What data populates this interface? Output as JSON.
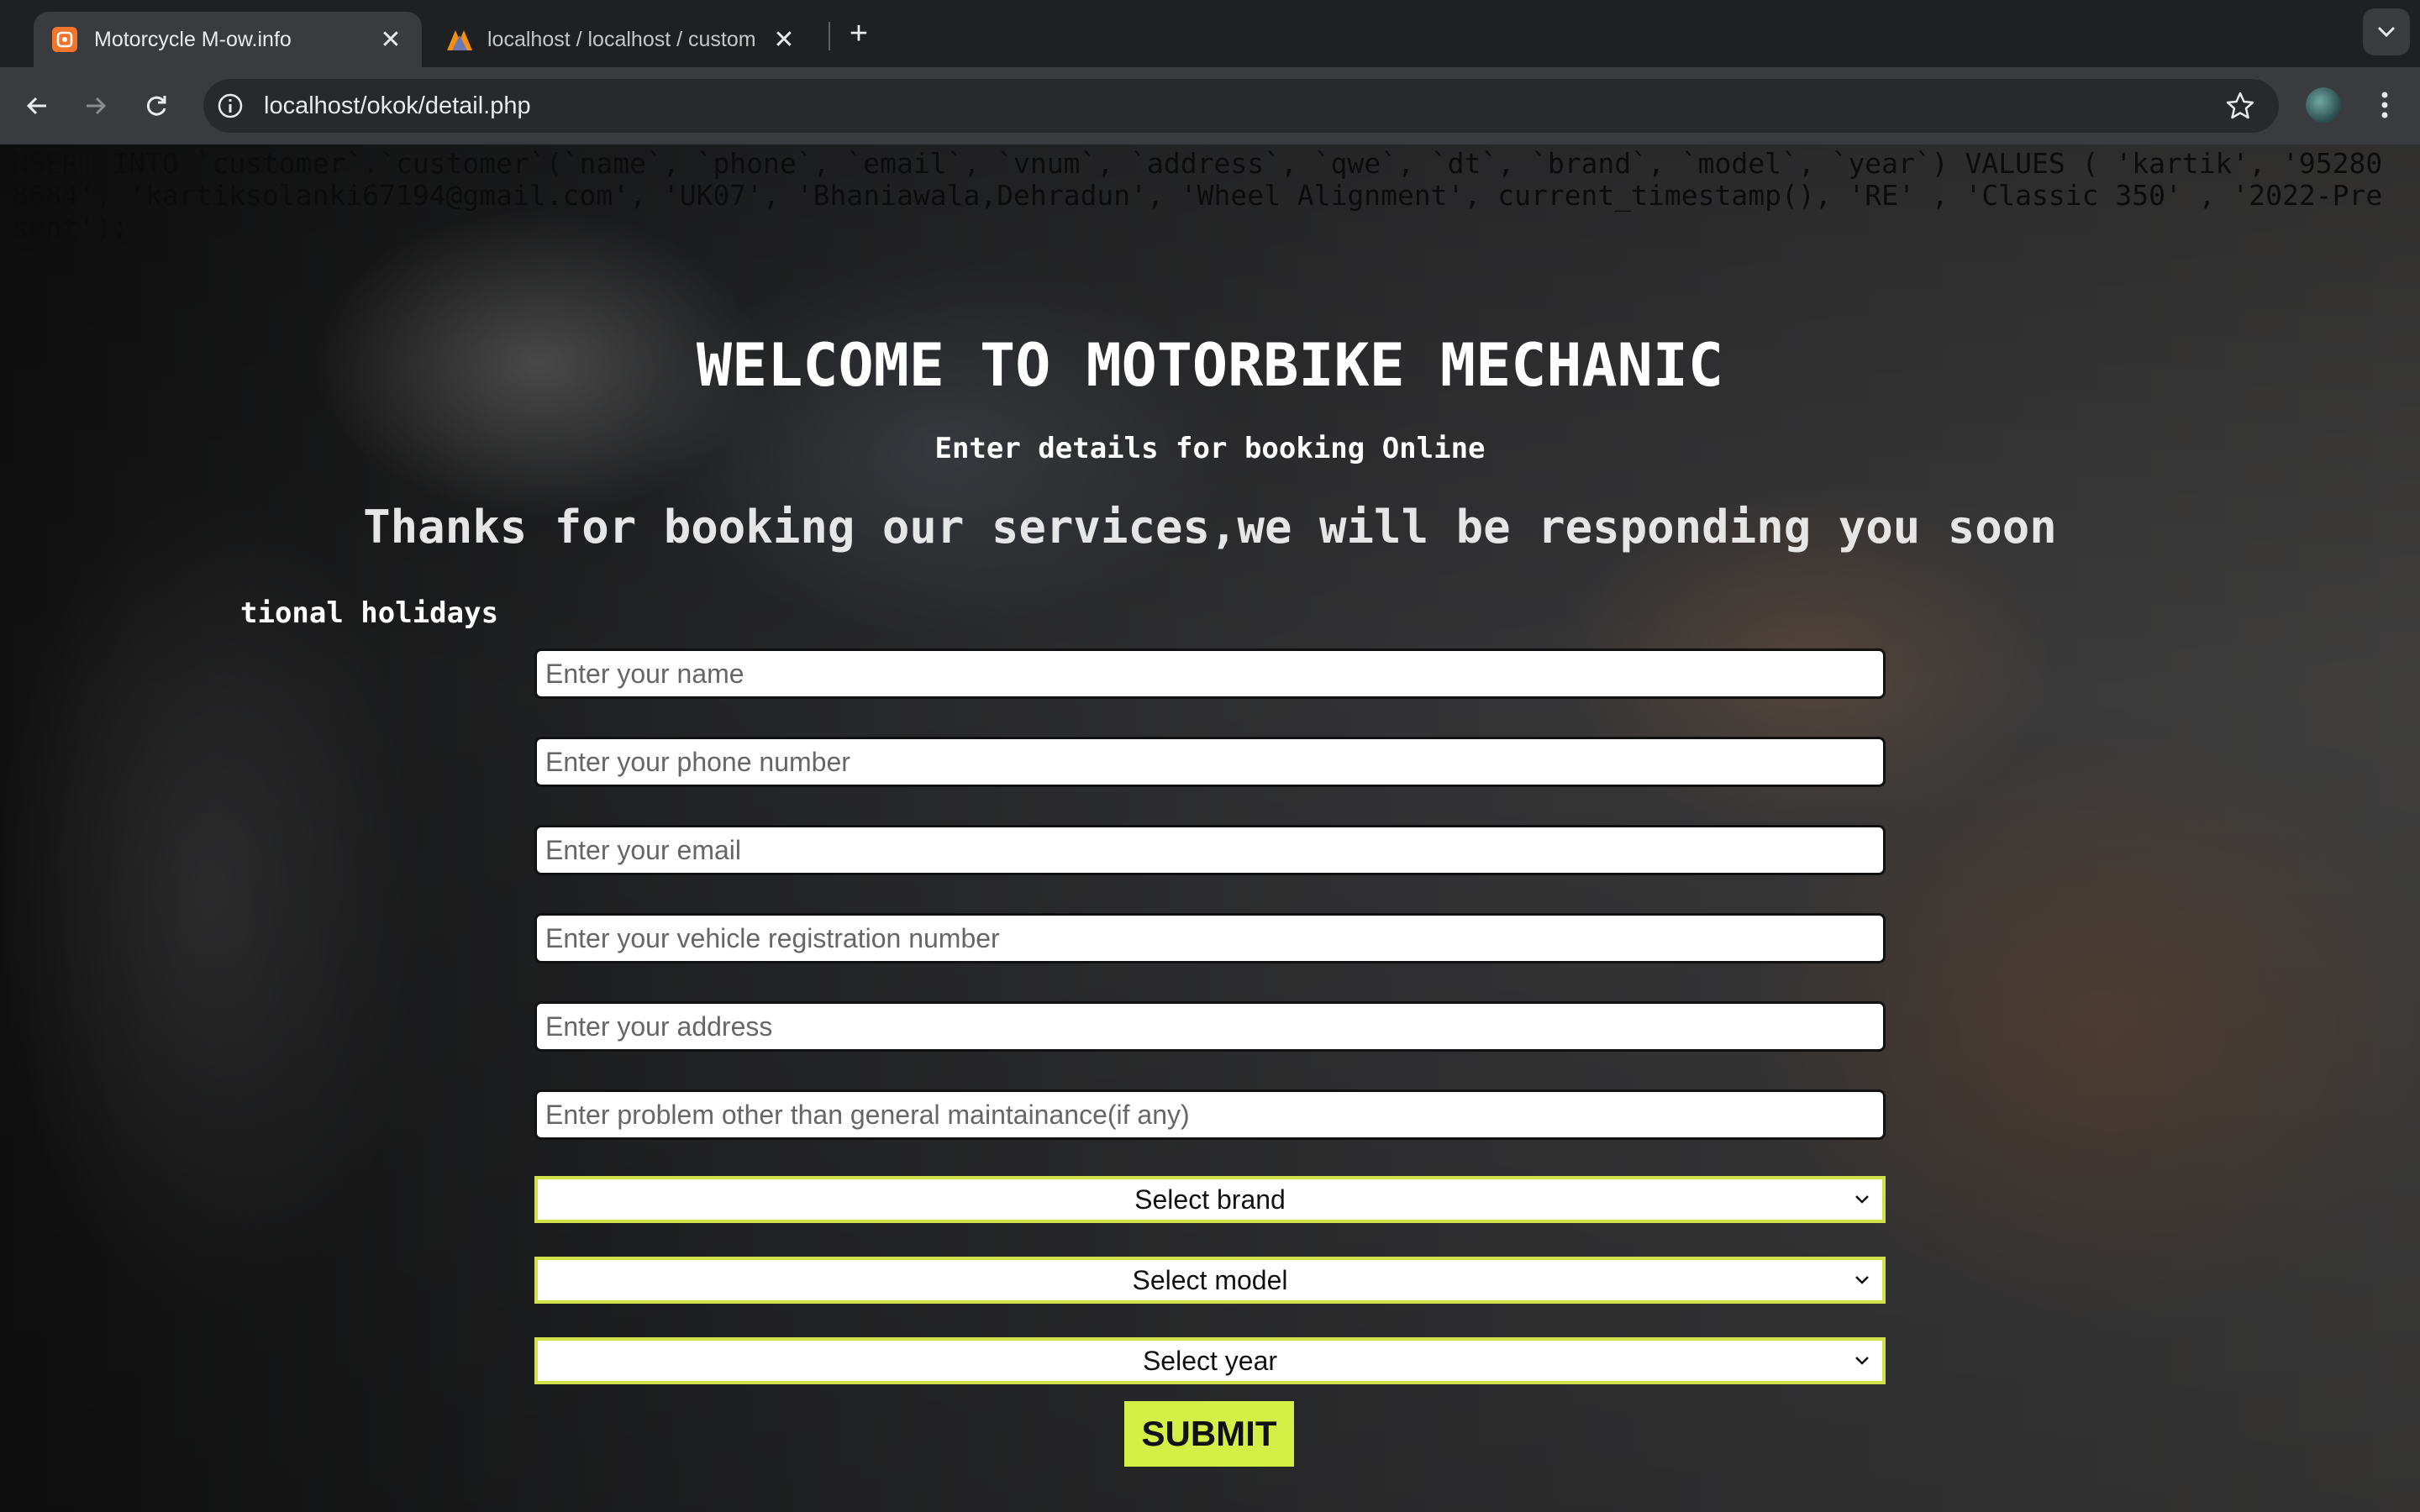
{
  "browser": {
    "tabs": [
      {
        "title": "Motorcycle M-ow.info",
        "favicon": "xampp-icon",
        "active": true
      },
      {
        "title": "localhost / localhost / custom",
        "favicon": "phpmyadmin-icon",
        "active": false
      }
    ],
    "url": "localhost/okok/detail.php",
    "accent_color": "#f3752b"
  },
  "page": {
    "sql_debug": "NSERT INTO `customer`.`customer`(`name`, `phone`, `email`, `vnum`, `address`, `qwe`, `dt`, `brand`, `model`, `year`) VALUES ( 'kartik', '952808684', 'kartiksolanki67194@gmail.com', 'UK07', 'Bhaniawala,Dehradun', 'Wheel Alignment', current_timestamp(), 'RE' , 'Classic 350' , '2022-Present');",
    "heading": "WELCOME TO MOTORBIKE MECHANIC",
    "subheading": "Enter details for booking Online",
    "thanks_message": "Thanks for booking our services,we will be responding you soon",
    "marquee_text": "tional holidays",
    "form": {
      "name_placeholder": "Enter your name",
      "phone_placeholder": "Enter your phone number",
      "email_placeholder": "Enter your email",
      "vehicle_placeholder": "Enter your vehicle registration number",
      "address_placeholder": "Enter your address",
      "problem_placeholder": "Enter problem other than general maintainance(if any)",
      "brand_select": "Select brand",
      "model_select": "Select model",
      "year_select": "Select year",
      "submit_label": "SUBMIT",
      "select_border_color": "#cfe24a",
      "submit_color": "#d4ef46"
    }
  }
}
